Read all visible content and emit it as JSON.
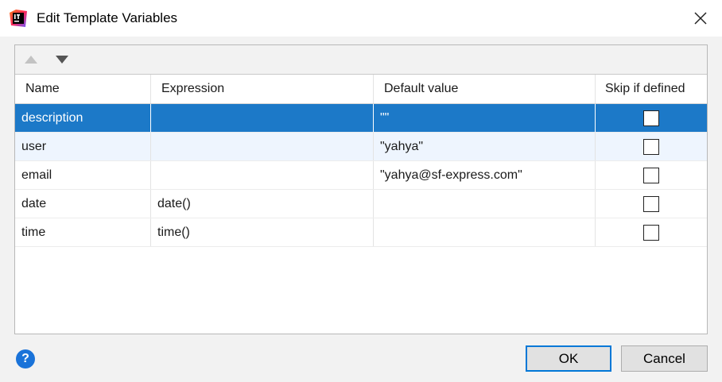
{
  "window": {
    "title": "Edit Template Variables",
    "app_icon": "intellij-idea-icon",
    "close_icon": "close-icon"
  },
  "toolbar": {
    "move_up_icon": "triangle-up-icon",
    "move_down_icon": "triangle-down-icon"
  },
  "table": {
    "columns": [
      "Name",
      "Expression",
      "Default value",
      "Skip if defined"
    ],
    "rows": [
      {
        "name": "description",
        "expression": "",
        "default_value": "\"\"",
        "skip_if_defined": false,
        "selected": true
      },
      {
        "name": "user",
        "expression": "",
        "default_value": "\"yahya\"",
        "skip_if_defined": false
      },
      {
        "name": "email",
        "expression": "",
        "default_value": "\"yahya@sf-express.com\"",
        "skip_if_defined": false
      },
      {
        "name": "date",
        "expression": "date()",
        "default_value": "",
        "skip_if_defined": false
      },
      {
        "name": "time",
        "expression": "time()",
        "default_value": "",
        "skip_if_defined": false
      }
    ]
  },
  "footer": {
    "help_label": "?",
    "ok_label": "OK",
    "cancel_label": "Cancel"
  },
  "colors": {
    "selection": "#1c79c8",
    "hover_row": "#eef5fe",
    "help": "#1a73d9",
    "ok_border": "#0078d7"
  }
}
